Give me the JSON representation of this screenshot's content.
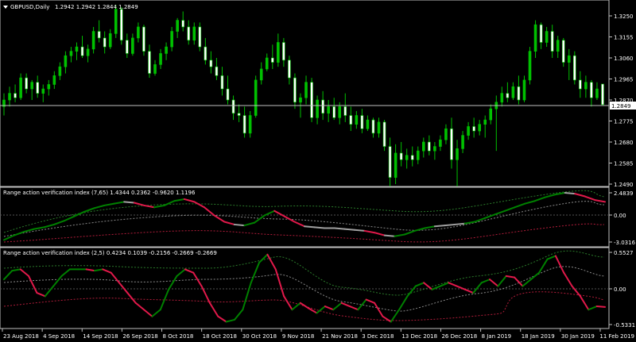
{
  "main_panel": {
    "symbol_label": "GBPUSD,Daily",
    "ohlc": "1.2942 1.2942 1.2844 1.2849",
    "price_ticks": [
      "1.3250",
      "1.3155",
      "1.3060",
      "1.2965",
      "1.2870",
      "1.2775",
      "1.2680",
      "1.2585",
      "1.2490"
    ],
    "current_price": "1.2849",
    "bull_color": "#00c000",
    "bear_color": "#ffffff",
    "level_line_color": "#c0c0c0"
  },
  "indicator_1": {
    "title": "Range action verification index (7,65) 1.4344 0.2362 -0.9620 1.1196",
    "ticks": [
      "2.4839",
      "0.00",
      "-3.0316"
    ]
  },
  "indicator_2": {
    "title": "Range action verification index (2,5) 0.4234 0.1039 -0.2156 -0.2669 -0.2669",
    "ticks": [
      "0.5527",
      "0.00",
      "-0.5331"
    ]
  },
  "time_axis": {
    "labels": [
      "23 Aug 2018",
      "4 Sep 2018",
      "14 Sep 2018",
      "26 Sep 2018",
      "8 Oct 2018",
      "18 Oct 2018",
      "30 Oct 2018",
      "9 Nov 2018",
      "21 Nov 2018",
      "3 Dec 2018",
      "13 Dec 2018",
      "26 Dec 2018",
      "8 Jan 2019",
      "18 Jan 2019",
      "30 Jan 2019",
      "11 Feb 2019"
    ]
  },
  "chart_data": {
    "type": "candlestick",
    "series": [
      {
        "name": "GBPUSD,Daily",
        "ohlc": [
          [
            1.284,
            1.29,
            1.28,
            1.287
          ],
          [
            1.287,
            1.293,
            1.284,
            1.29
          ],
          [
            1.29,
            1.294,
            1.286,
            1.288
          ],
          [
            1.288,
            1.299,
            1.287,
            1.297
          ],
          [
            1.297,
            1.299,
            1.29,
            1.292
          ],
          [
            1.292,
            1.296,
            1.287,
            1.295
          ],
          [
            1.295,
            1.298,
            1.288,
            1.29
          ],
          [
            1.29,
            1.294,
            1.286,
            1.292
          ],
          [
            1.292,
            1.296,
            1.289,
            1.294
          ],
          [
            1.294,
            1.3,
            1.292,
            1.298
          ],
          [
            1.298,
            1.304,
            1.296,
            1.302
          ],
          [
            1.302,
            1.309,
            1.299,
            1.307
          ],
          [
            1.307,
            1.311,
            1.304,
            1.309
          ],
          [
            1.309,
            1.313,
            1.305,
            1.311
          ],
          [
            1.311,
            1.316,
            1.306,
            1.307
          ],
          [
            1.307,
            1.312,
            1.304,
            1.31
          ],
          [
            1.31,
            1.32,
            1.308,
            1.318
          ],
          [
            1.318,
            1.323,
            1.313,
            1.315
          ],
          [
            1.315,
            1.318,
            1.308,
            1.311
          ],
          [
            1.311,
            1.319,
            1.31,
            1.317
          ],
          [
            1.317,
            1.33,
            1.315,
            1.328
          ],
          [
            1.328,
            1.329,
            1.312,
            1.314
          ],
          [
            1.314,
            1.317,
            1.306,
            1.308
          ],
          [
            1.308,
            1.317,
            1.307,
            1.315
          ],
          [
            1.315,
            1.322,
            1.313,
            1.32
          ],
          [
            1.32,
            1.321,
            1.307,
            1.309
          ],
          [
            1.309,
            1.312,
            1.297,
            1.299
          ],
          [
            1.299,
            1.305,
            1.298,
            1.303
          ],
          [
            1.303,
            1.31,
            1.301,
            1.308
          ],
          [
            1.308,
            1.313,
            1.305,
            1.311
          ],
          [
            1.311,
            1.32,
            1.309,
            1.318
          ],
          [
            1.318,
            1.324,
            1.315,
            1.323
          ],
          [
            1.323,
            1.327,
            1.318,
            1.32
          ],
          [
            1.32,
            1.323,
            1.312,
            1.314
          ],
          [
            1.314,
            1.322,
            1.312,
            1.32
          ],
          [
            1.32,
            1.322,
            1.309,
            1.311
          ],
          [
            1.311,
            1.315,
            1.303,
            1.305
          ],
          [
            1.305,
            1.309,
            1.299,
            1.302
          ],
          [
            1.302,
            1.306,
            1.296,
            1.298
          ],
          [
            1.298,
            1.302,
            1.289,
            1.292
          ],
          [
            1.292,
            1.298,
            1.285,
            1.287
          ],
          [
            1.287,
            1.289,
            1.278,
            1.281
          ],
          [
            1.281,
            1.285,
            1.277,
            1.28
          ],
          [
            1.28,
            1.284,
            1.27,
            1.272
          ],
          [
            1.272,
            1.282,
            1.27,
            1.28
          ],
          [
            1.28,
            1.298,
            1.279,
            1.296
          ],
          [
            1.296,
            1.304,
            1.294,
            1.301
          ],
          [
            1.301,
            1.308,
            1.3,
            1.306
          ],
          [
            1.306,
            1.312,
            1.301,
            1.304
          ],
          [
            1.304,
            1.317,
            1.302,
            1.313
          ],
          [
            1.313,
            1.315,
            1.302,
            1.305
          ],
          [
            1.305,
            1.307,
            1.294,
            1.297
          ],
          [
            1.297,
            1.299,
            1.283,
            1.286
          ],
          [
            1.286,
            1.29,
            1.279,
            1.288
          ],
          [
            1.288,
            1.298,
            1.285,
            1.295
          ],
          [
            1.295,
            1.297,
            1.277,
            1.279
          ],
          [
            1.279,
            1.289,
            1.276,
            1.287
          ],
          [
            1.287,
            1.291,
            1.278,
            1.281
          ],
          [
            1.281,
            1.287,
            1.277,
            1.284
          ],
          [
            1.284,
            1.288,
            1.278,
            1.279
          ],
          [
            1.279,
            1.286,
            1.276,
            1.284
          ],
          [
            1.284,
            1.29,
            1.277,
            1.28
          ],
          [
            1.28,
            1.284,
            1.273,
            1.276
          ],
          [
            1.276,
            1.282,
            1.274,
            1.28
          ],
          [
            1.28,
            1.283,
            1.272,
            1.274
          ],
          [
            1.274,
            1.28,
            1.273,
            1.278
          ],
          [
            1.278,
            1.279,
            1.27,
            1.272
          ],
          [
            1.272,
            1.279,
            1.27,
            1.277
          ],
          [
            1.277,
            1.278,
            1.264,
            1.266
          ],
          [
            1.266,
            1.27,
            1.248,
            1.252
          ],
          [
            1.252,
            1.267,
            1.249,
            1.263
          ],
          [
            1.263,
            1.268,
            1.257,
            1.26
          ],
          [
            1.26,
            1.265,
            1.256,
            1.262
          ],
          [
            1.262,
            1.266,
            1.257,
            1.26
          ],
          [
            1.26,
            1.266,
            1.258,
            1.264
          ],
          [
            1.264,
            1.27,
            1.261,
            1.268
          ],
          [
            1.268,
            1.271,
            1.262,
            1.264
          ],
          [
            1.264,
            1.268,
            1.26,
            1.266
          ],
          [
            1.266,
            1.271,
            1.264,
            1.269
          ],
          [
            1.269,
            1.276,
            1.267,
            1.274
          ],
          [
            1.274,
            1.279,
            1.256,
            1.26
          ],
          [
            1.26,
            1.269,
            1.248,
            1.265
          ],
          [
            1.265,
            1.273,
            1.263,
            1.271
          ],
          [
            1.271,
            1.277,
            1.269,
            1.275
          ],
          [
            1.275,
            1.279,
            1.27,
            1.273
          ],
          [
            1.273,
            1.278,
            1.271,
            1.276
          ],
          [
            1.276,
            1.28,
            1.27,
            1.278
          ],
          [
            1.278,
            1.285,
            1.276,
            1.283
          ],
          [
            1.283,
            1.289,
            1.264,
            1.286
          ],
          [
            1.286,
            1.293,
            1.284,
            1.29
          ],
          [
            1.29,
            1.295,
            1.286,
            1.288
          ],
          [
            1.288,
            1.295,
            1.287,
            1.293
          ],
          [
            1.293,
            1.298,
            1.285,
            1.287
          ],
          [
            1.287,
            1.298,
            1.286,
            1.296
          ],
          [
            1.296,
            1.311,
            1.294,
            1.309
          ],
          [
            1.309,
            1.323,
            1.306,
            1.321
          ],
          [
            1.321,
            1.322,
            1.31,
            1.313
          ],
          [
            1.313,
            1.32,
            1.311,
            1.318
          ],
          [
            1.318,
            1.321,
            1.306,
            1.309
          ],
          [
            1.309,
            1.316,
            1.306,
            1.314
          ],
          [
            1.314,
            1.315,
            1.302,
            1.304
          ],
          [
            1.304,
            1.31,
            1.296,
            1.307
          ],
          [
            1.307,
            1.309,
            1.294,
            1.296
          ],
          [
            1.296,
            1.3,
            1.288,
            1.292
          ],
          [
            1.292,
            1.298,
            1.288,
            1.295
          ],
          [
            1.295,
            1.296,
            1.284,
            1.288
          ],
          [
            1.288,
            1.295,
            1.287,
            1.292
          ],
          [
            1.2942,
            1.2942,
            1.2844,
            1.2849
          ]
        ]
      }
    ],
    "x_start_label": "23 Aug 2018",
    "x_end_label": "11 Feb 2019",
    "ylim": [
      1.249,
      1.325
    ],
    "last_price": 1.2849,
    "indicators": [
      {
        "title": "Range action verification index (7,65) 1.4344 0.2362 -0.9620 1.1196",
        "ylim": [
          -3.0316,
          2.4839
        ],
        "main_line": [
          -2.8,
          -2.3,
          -1.9,
          -1.6,
          -1.4,
          -1.1,
          -0.7,
          -0.2,
          0.3,
          0.7,
          1.0,
          1.2,
          1.4,
          1.3,
          1.0,
          0.8,
          1.0,
          1.5,
          1.7,
          1.4,
          0.8,
          -0.1,
          -0.8,
          -1.1,
          -1.2,
          -0.9,
          -0.1,
          0.4,
          -0.2,
          -0.8,
          -1.3,
          -1.4,
          -1.5,
          -1.5,
          -1.6,
          -1.7,
          -1.8,
          -2.0,
          -2.3,
          -2.4,
          -2.2,
          -1.8,
          -1.5,
          -1.3,
          -1.2,
          -1.1,
          -1.0,
          -0.8,
          -0.4,
          0.0,
          0.4,
          0.8,
          1.2,
          1.5,
          1.9,
          2.2,
          2.4,
          2.3,
          2.0,
          1.6,
          1.4
        ],
        "line_colors": {
          "rising": "#008000",
          "falling": "#e0194a",
          "neutral": "#a0a0a0"
        }
      },
      {
        "title": "Range action verification index (2,5) 0.4234 0.1039 -0.2156 -0.2669 -0.2669",
        "ylim": [
          -0.5331,
          0.5527
        ],
        "main_line": [
          0.15,
          0.28,
          0.3,
          0.2,
          -0.05,
          -0.1,
          0.05,
          0.2,
          0.3,
          0.3,
          0.3,
          0.28,
          0.3,
          0.25,
          0.1,
          -0.05,
          -0.2,
          -0.3,
          -0.4,
          -0.3,
          0.0,
          0.2,
          0.3,
          0.25,
          0.05,
          -0.2,
          -0.4,
          -0.48,
          -0.45,
          -0.3,
          0.1,
          0.4,
          0.52,
          0.3,
          -0.1,
          -0.3,
          -0.2,
          -0.28,
          -0.35,
          -0.25,
          -0.3,
          -0.2,
          -0.25,
          -0.3,
          -0.15,
          -0.2,
          -0.4,
          -0.48,
          -0.3,
          -0.1,
          0.05,
          0.1,
          0.0,
          0.05,
          0.1,
          0.05,
          0.0,
          -0.05,
          0.1,
          0.15,
          0.05,
          0.2,
          0.18,
          0.05,
          0.15,
          0.25,
          0.45,
          0.5,
          0.25,
          0.05,
          -0.1,
          -0.3,
          -0.25,
          -0.26
        ],
        "line_colors": {
          "rising": "#008000",
          "falling": "#e0194a"
        }
      }
    ]
  }
}
